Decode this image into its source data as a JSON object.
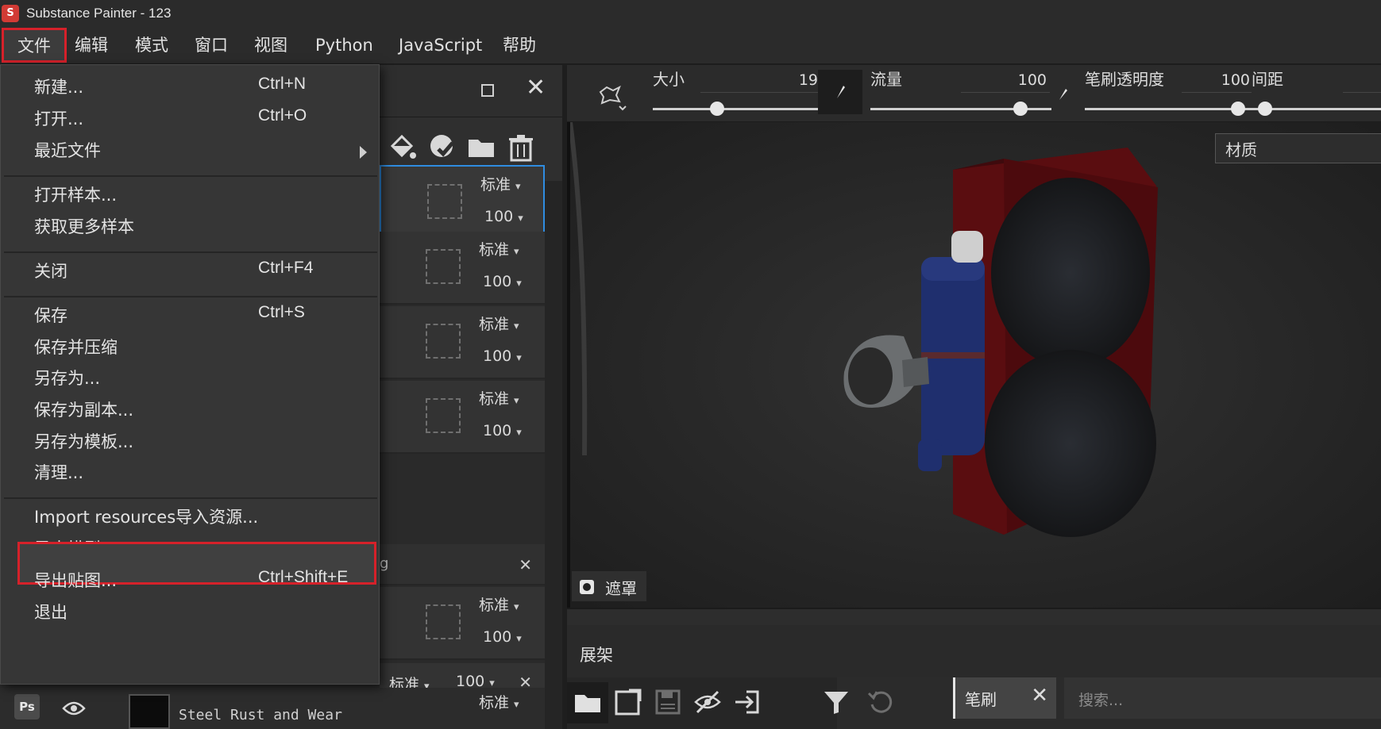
{
  "window": {
    "title": "Substance Painter - 123",
    "logo": "S"
  },
  "menubar": {
    "items": [
      "文件",
      "编辑",
      "模式",
      "窗口",
      "视图",
      "Python",
      "JavaScript",
      "帮助"
    ]
  },
  "file_menu": {
    "items": [
      {
        "label": "新建...",
        "shortcut": "Ctrl+N"
      },
      {
        "label": "打开...",
        "shortcut": "Ctrl+O"
      },
      {
        "label": "最近文件",
        "shortcut": ""
      },
      {
        "label": "打开样本...",
        "shortcut": ""
      },
      {
        "label": "获取更多样本",
        "shortcut": ""
      },
      {
        "label": "关闭",
        "shortcut": "Ctrl+F4"
      },
      {
        "label": "保存",
        "shortcut": "Ctrl+S"
      },
      {
        "label": "保存并压缩",
        "shortcut": ""
      },
      {
        "label": "另存为...",
        "shortcut": ""
      },
      {
        "label": "保存为副本...",
        "shortcut": ""
      },
      {
        "label": "另存为模板...",
        "shortcut": ""
      },
      {
        "label": "清理...",
        "shortcut": ""
      },
      {
        "label": "Import resources导入资源...",
        "shortcut": ""
      },
      {
        "label": "导出模型...",
        "shortcut": ""
      },
      {
        "label": "导出贴图...",
        "shortcut": "Ctrl+Shift+E"
      },
      {
        "label": "退出",
        "shortcut": ""
      }
    ]
  },
  "layers": {
    "rows": [
      {
        "blend": "标准",
        "opacity": "100"
      },
      {
        "blend": "标准",
        "opacity": "100"
      },
      {
        "blend": "标准",
        "opacity": "100"
      },
      {
        "blend": "标准",
        "opacity": "100"
      },
      {
        "blend": "标准",
        "opacity": "100"
      }
    ],
    "folder_fragment": "g",
    "compact_rows": [
      {
        "blend": "标准",
        "opacity": "100"
      },
      {
        "blend": "标准",
        "opacity": "100"
      }
    ],
    "bottom_layer": {
      "badge": "Ps",
      "name": "Steel Rust and Wear",
      "blend": "标准"
    }
  },
  "brush_bar": {
    "size_label": "大小",
    "size_value": "19",
    "flow_label": "流量",
    "flow_value": "100",
    "opacity_label": "笔刷透明度",
    "opacity_value": "100",
    "spacing_label": "间距"
  },
  "viewport": {
    "channel_select": "材质",
    "mask_label": "遮罩"
  },
  "shelf": {
    "title": "展架",
    "filter_tag": "笔刷",
    "search_placeholder": "搜索..."
  },
  "colors": {
    "highlight_red": "#d6212a",
    "selection_blue": "#2f8ce0",
    "box_red": "#5a0d10",
    "box_blue": "#1f2f6e"
  }
}
